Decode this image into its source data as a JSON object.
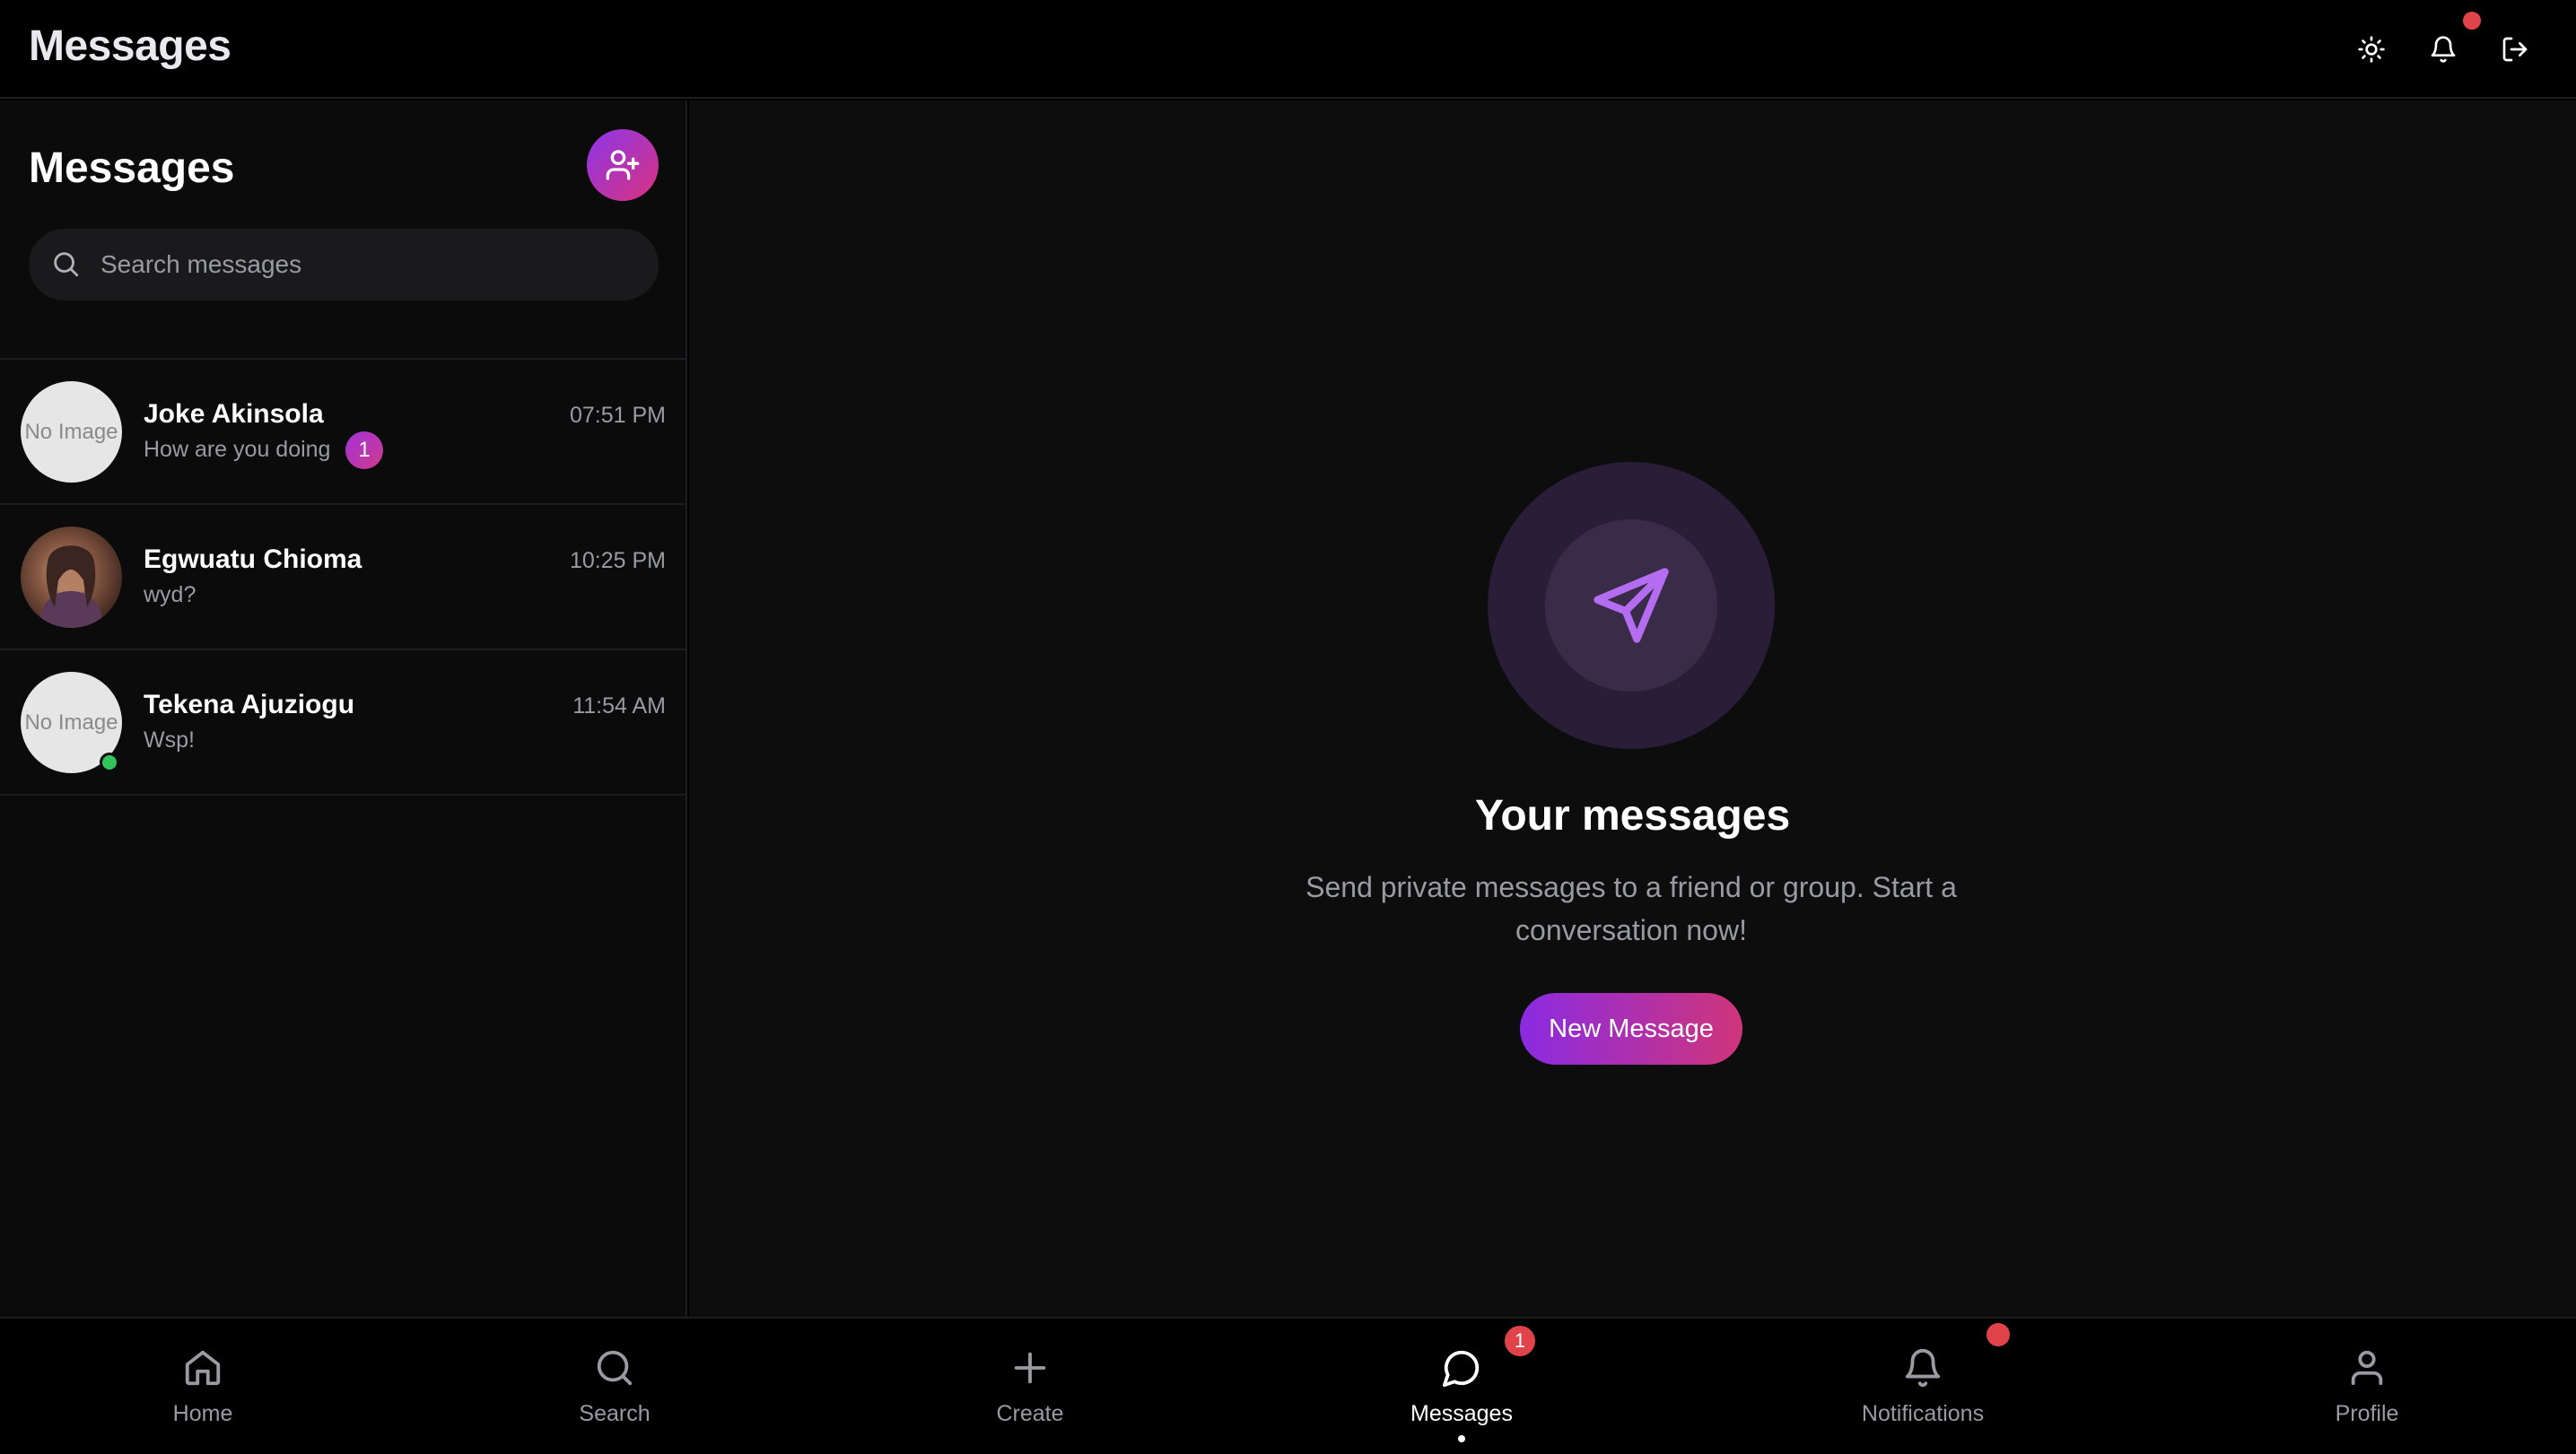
{
  "header": {
    "title": "Messages",
    "icons": [
      "sun-icon",
      "bell-icon",
      "logout-icon"
    ],
    "notification_dot": true
  },
  "sidebar": {
    "title": "Messages",
    "new_chat_icon": "user-plus-icon",
    "search": {
      "placeholder": "Search messages",
      "value": ""
    },
    "conversations": [
      {
        "name": "Joke Akinsola",
        "preview": "How are you doing",
        "time": "07:51 PM",
        "avatar": "No Image",
        "unread": "1",
        "online": false
      },
      {
        "name": "Egwuatu Chioma",
        "preview": "wyd?",
        "time": "10:25 PM",
        "avatar": "",
        "unread": "",
        "online": false
      },
      {
        "name": "Tekena Ajuziogu",
        "preview": "Wsp!",
        "time": "11:54 AM",
        "avatar": "No Image",
        "unread": "",
        "online": true
      }
    ]
  },
  "main": {
    "empty_title": "Your messages",
    "empty_subtitle": "Send private messages to a friend or group. Start a conversation now!",
    "button_label": "New Message",
    "hero_icon": "paper-plane-icon"
  },
  "bottom_nav": {
    "items": [
      {
        "label": "Home",
        "icon": "home-icon"
      },
      {
        "label": "Search",
        "icon": "search-icon"
      },
      {
        "label": "Create",
        "icon": "plus-icon"
      },
      {
        "label": "Messages",
        "icon": "chat-bubble-icon",
        "badge": "1",
        "active": true
      },
      {
        "label": "Notifications",
        "icon": "bell-icon",
        "dot": true
      },
      {
        "label": "Profile",
        "icon": "user-icon"
      }
    ]
  },
  "colors": {
    "accent_start": "#8a2be2",
    "accent_end": "#d0357a",
    "notification_red": "#e0434a",
    "online_green": "#32c35a",
    "background": "#000000"
  }
}
